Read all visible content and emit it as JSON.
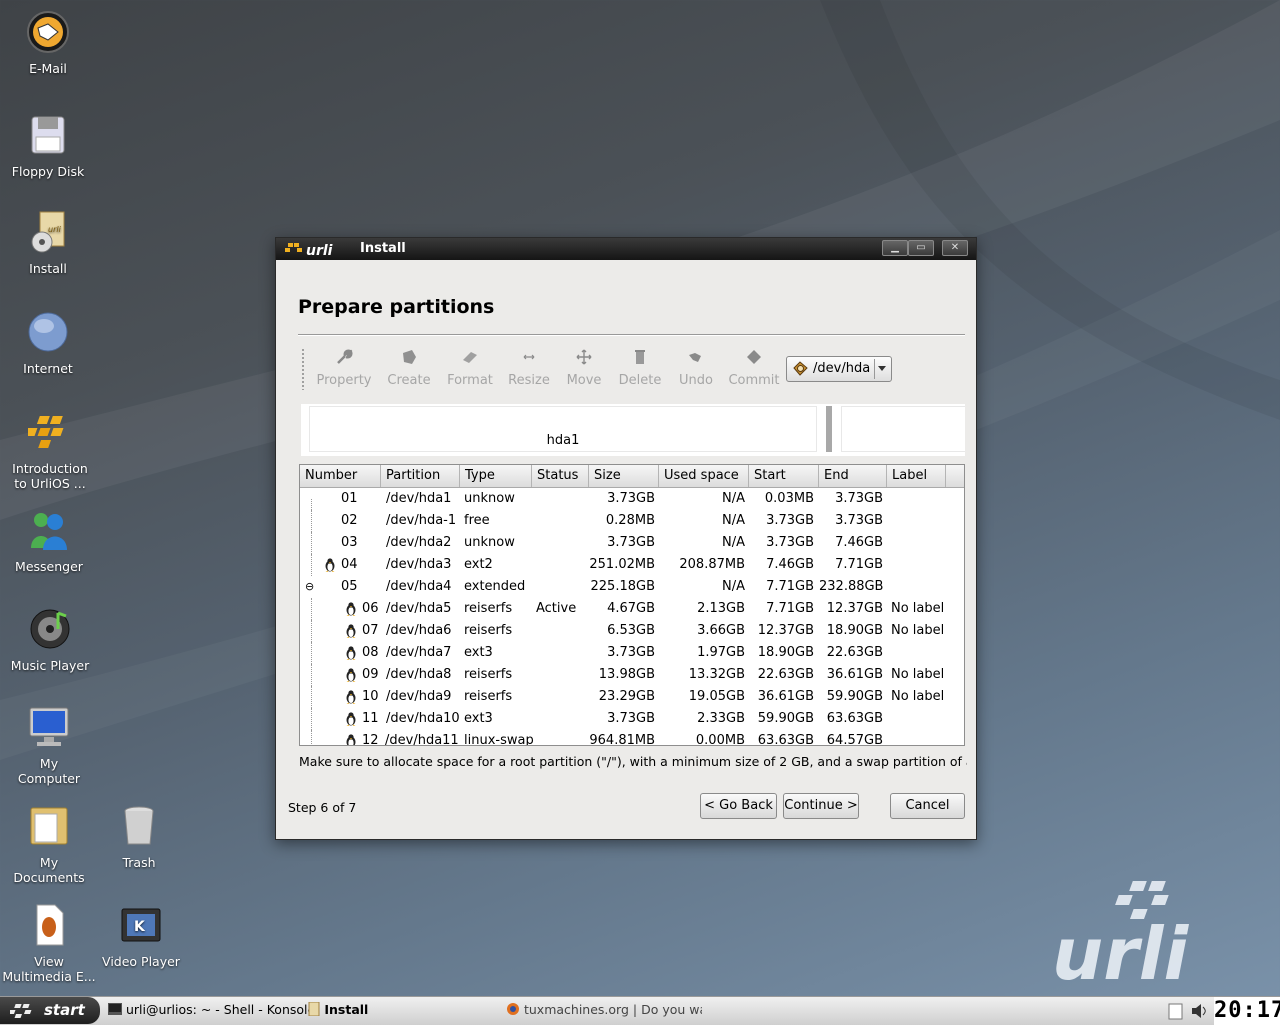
{
  "desktop": {
    "icons": [
      {
        "label": "E-Mail"
      },
      {
        "label": "Floppy Disk"
      },
      {
        "label": "Install"
      },
      {
        "label": "Internet"
      },
      {
        "label": "Introduction\nto UrliOS ..."
      },
      {
        "label": "Messenger"
      },
      {
        "label": "Music Player"
      },
      {
        "label": "My\nComputer"
      },
      {
        "label": "My\nDocuments"
      },
      {
        "label": "Trash"
      },
      {
        "label": "View\nMultimedia E..."
      },
      {
        "label": "Video Player"
      }
    ],
    "brand": "urli"
  },
  "window": {
    "title": "Install",
    "logo_text": "urli",
    "heading": "Prepare partitions",
    "toolbar": {
      "tools": [
        {
          "label": "Property",
          "icon": "wrench-icon"
        },
        {
          "label": "Create",
          "icon": "create-icon"
        },
        {
          "label": "Format",
          "icon": "eraser-icon"
        },
        {
          "label": "Resize",
          "icon": "resize-icon"
        },
        {
          "label": "Move",
          "icon": "move-icon"
        },
        {
          "label": "Delete",
          "icon": "trash-icon"
        },
        {
          "label": "Undo",
          "icon": "undo-icon"
        },
        {
          "label": "Commit",
          "icon": "commit-icon"
        }
      ],
      "device": "/dev/hda"
    },
    "graph": {
      "selected_partition": "hda1"
    },
    "table": {
      "columns": [
        "Number",
        "Partition",
        "Type",
        "Status",
        "Size",
        "Used space",
        "Start",
        "End",
        "Label"
      ],
      "rows": [
        {
          "number": "01",
          "partition": "/dev/hda1",
          "type": "unknow",
          "status": "",
          "size": "3.73GB",
          "used": "N/A",
          "start": "0.03MB",
          "end": "3.73GB",
          "label": "",
          "tux": false,
          "level": 0
        },
        {
          "number": "02",
          "partition": "/dev/hda-1",
          "type": "free",
          "status": "",
          "size": "0.28MB",
          "used": "N/A",
          "start": "3.73GB",
          "end": "3.73GB",
          "label": "",
          "tux": false,
          "level": 0
        },
        {
          "number": "03",
          "partition": "/dev/hda2",
          "type": "unknow",
          "status": "",
          "size": "3.73GB",
          "used": "N/A",
          "start": "3.73GB",
          "end": "7.46GB",
          "label": "",
          "tux": false,
          "level": 0
        },
        {
          "number": "04",
          "partition": "/dev/hda3",
          "type": "ext2",
          "status": "",
          "size": "251.02MB",
          "used": "208.87MB",
          "start": "7.46GB",
          "end": "7.71GB",
          "label": "",
          "tux": true,
          "level": 0
        },
        {
          "number": "05",
          "partition": "/dev/hda4",
          "type": "extended",
          "status": "",
          "size": "225.18GB",
          "used": "N/A",
          "start": "7.71GB",
          "end": "232.88GB",
          "label": "",
          "tux": false,
          "level": 0,
          "expander": "⊖"
        },
        {
          "number": "06",
          "partition": "/dev/hda5",
          "type": "reiserfs",
          "status": "Active",
          "size": "4.67GB",
          "used": "2.13GB",
          "start": "7.71GB",
          "end": "12.37GB",
          "label": "No label",
          "tux": true,
          "level": 1
        },
        {
          "number": "07",
          "partition": "/dev/hda6",
          "type": "reiserfs",
          "status": "",
          "size": "6.53GB",
          "used": "3.66GB",
          "start": "12.37GB",
          "end": "18.90GB",
          "label": "No label",
          "tux": true,
          "level": 1
        },
        {
          "number": "08",
          "partition": "/dev/hda7",
          "type": "ext3",
          "status": "",
          "size": "3.73GB",
          "used": "1.97GB",
          "start": "18.90GB",
          "end": "22.63GB",
          "label": "",
          "tux": true,
          "level": 1
        },
        {
          "number": "09",
          "partition": "/dev/hda8",
          "type": "reiserfs",
          "status": "",
          "size": "13.98GB",
          "used": "13.32GB",
          "start": "22.63GB",
          "end": "36.61GB",
          "label": "No label",
          "tux": true,
          "level": 1
        },
        {
          "number": "10",
          "partition": "/dev/hda9",
          "type": "reiserfs",
          "status": "",
          "size": "23.29GB",
          "used": "19.05GB",
          "start": "36.61GB",
          "end": "59.90GB",
          "label": "No label",
          "tux": true,
          "level": 1
        },
        {
          "number": "11",
          "partition": "/dev/hda10",
          "type": "ext3",
          "status": "",
          "size": "3.73GB",
          "used": "2.33GB",
          "start": "59.90GB",
          "end": "63.63GB",
          "label": "",
          "tux": true,
          "level": 1
        },
        {
          "number": "12",
          "partition": "/dev/hda11",
          "type": "linux-swap",
          "status": "",
          "size": "964.81MB",
          "used": "0.00MB",
          "start": "63.63GB",
          "end": "64.57GB",
          "label": "",
          "tux": true,
          "level": 1
        }
      ]
    },
    "notice": "Make sure to allocate space for a root partition (\"/\"), with a minimum size of 2 GB, and a swap partition of at least",
    "step": "Step 6 of 7",
    "buttons": {
      "back": "< Go Back",
      "continue": "Continue >",
      "cancel": "Cancel"
    }
  },
  "taskbar": {
    "start": "start",
    "tasks": [
      {
        "label": "urli@urlios: ~ - Shell - Konsole"
      },
      {
        "label": "Install"
      },
      {
        "label": "tuxmachines.org | Do you wadd"
      }
    ],
    "clock": "20:17"
  }
}
